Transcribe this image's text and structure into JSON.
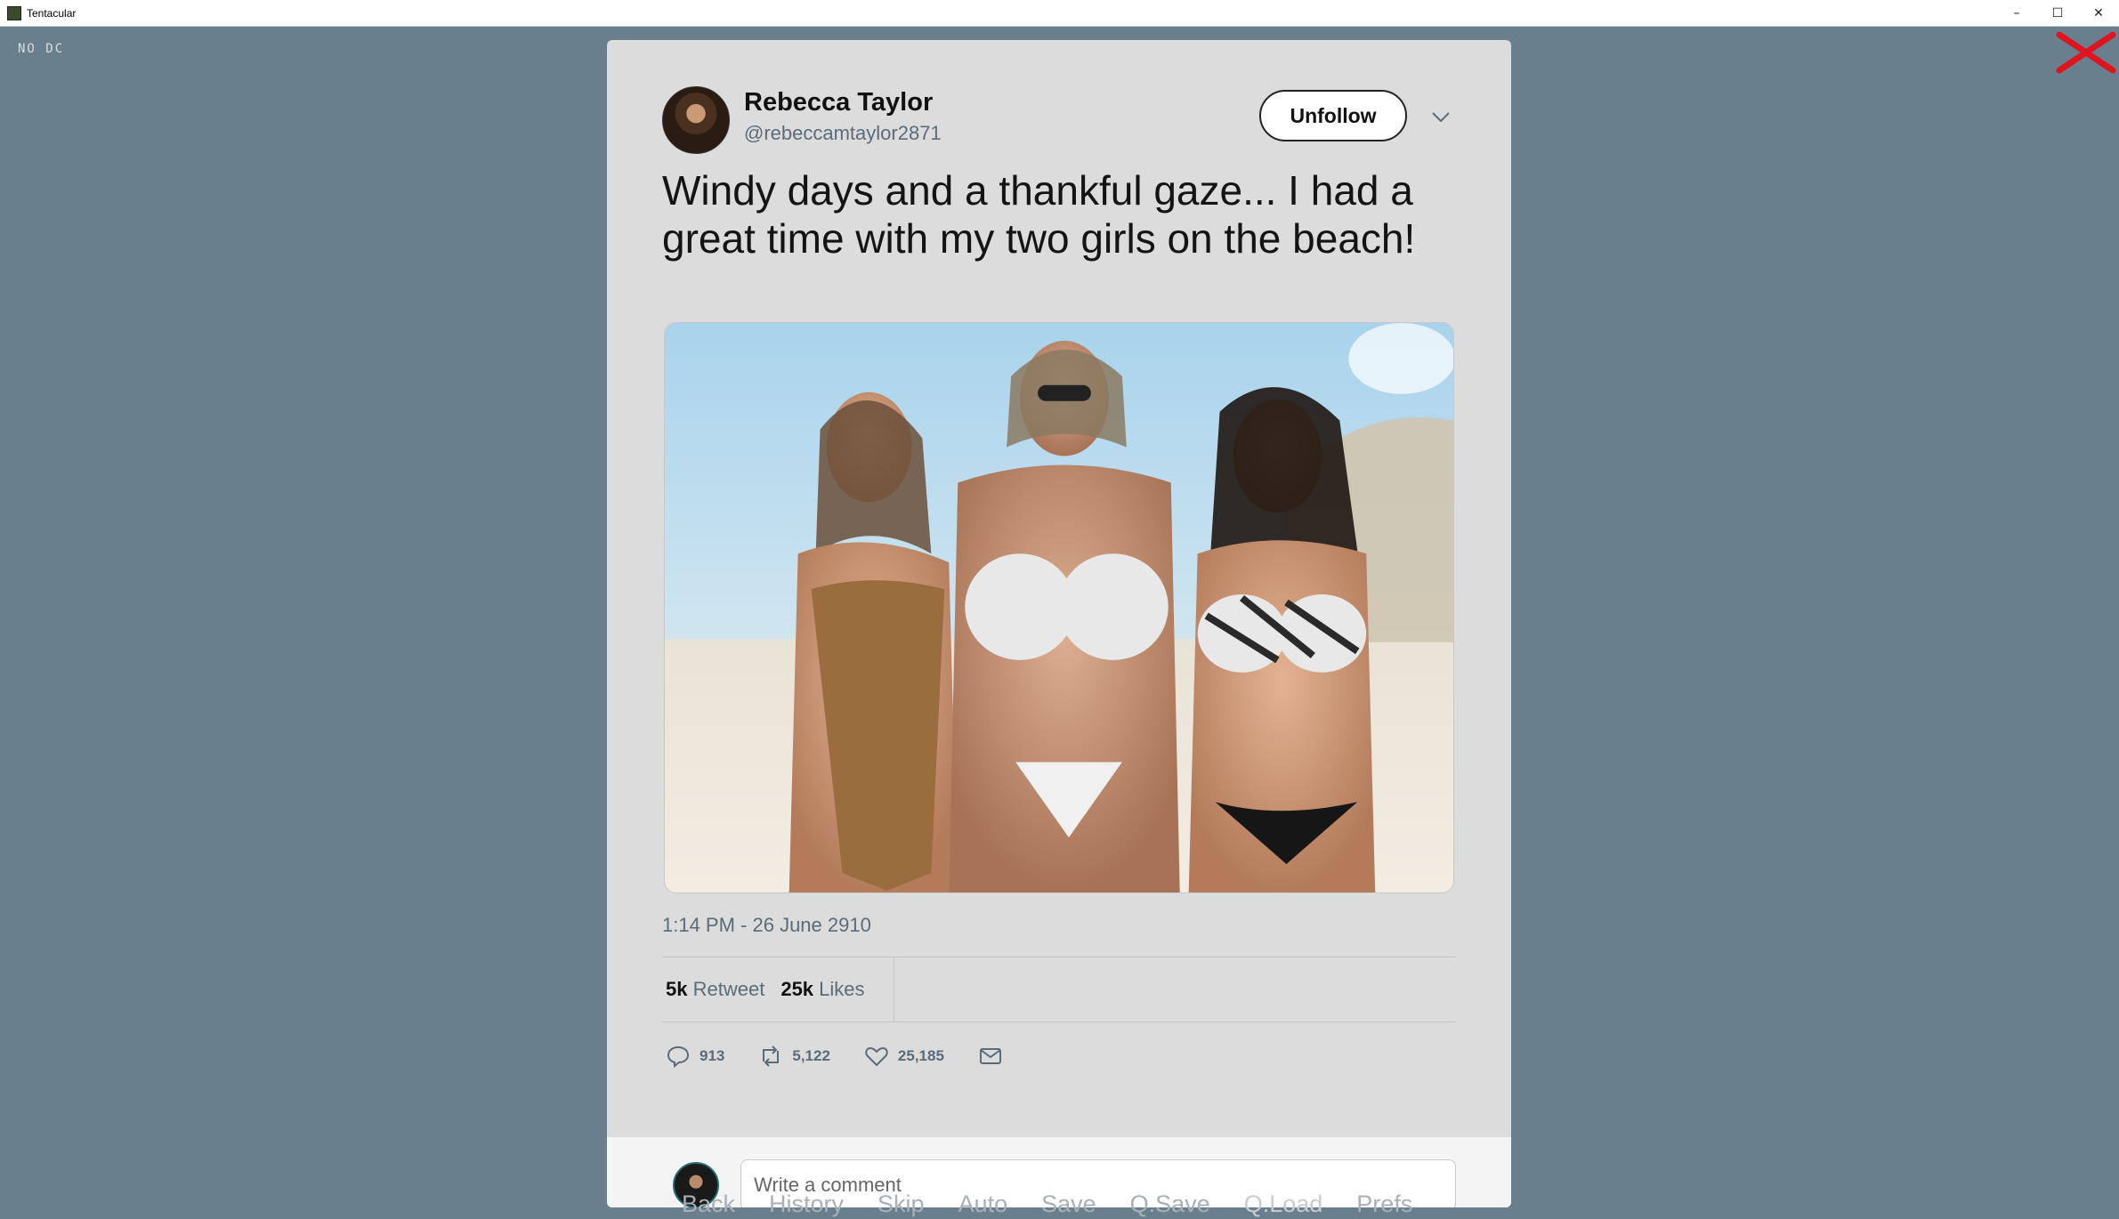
{
  "window": {
    "title": "Tentacular",
    "controls": {
      "minimize": "–",
      "maximize": "☐",
      "close": "✕"
    }
  },
  "overlay": {
    "nodc_label": "NO DC",
    "close_color": "#e0141e"
  },
  "tweet": {
    "author_name": "Rebecca Taylor",
    "author_handle": "@rebeccamtaylor2871",
    "follow_button": "Unfollow",
    "text": "Windy days and a thankful gaze... I had a great time with my two girls on the beach!",
    "timestamp": "1:14 PM - 26 June 2910",
    "retweets_count": "5k",
    "retweets_label": "Retweet",
    "likes_count": "25k",
    "likes_label": "Likes",
    "actions": {
      "replies": "913",
      "retweets": "5,122",
      "likes": "25,185"
    },
    "icons": [
      "reply-icon",
      "retweet-icon",
      "heart-icon",
      "mail-icon",
      "chevron-down-icon"
    ]
  },
  "comment": {
    "placeholder": "Write a comment"
  },
  "quick_menu": {
    "items": [
      "Back",
      "History",
      "Skip",
      "Auto",
      "Save",
      "Q.Save",
      "Q.Load",
      "Prefs"
    ]
  }
}
